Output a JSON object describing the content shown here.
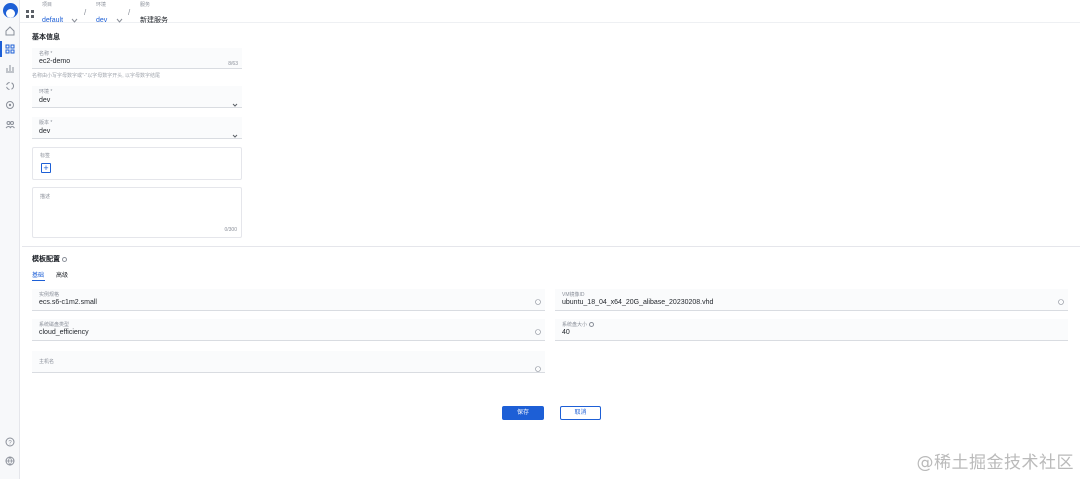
{
  "header": {
    "breadcrumbs": [
      {
        "label": "项目",
        "value": "default"
      },
      {
        "label": "环境",
        "value": "dev"
      },
      {
        "label": "服务",
        "value": "新建服务"
      }
    ]
  },
  "basic_info": {
    "title": "基本信息",
    "name_field": {
      "label": "名称 *",
      "value": "ec2-demo",
      "counter": "8/63",
      "hint": "名称由小写字母数字或\"-\"以字母数字开头, 以字母数字结尾"
    },
    "env_field": {
      "label": "环境 *",
      "value": "dev"
    },
    "version_field": {
      "label": "版本 *",
      "value": "dev"
    },
    "tags_field": {
      "label": "标签"
    },
    "desc_field": {
      "label": "描述",
      "counter": "0/300"
    }
  },
  "template_config": {
    "title": "模板配置",
    "tabs": [
      {
        "label": "基础",
        "active": true
      },
      {
        "label": "高级",
        "active": false
      }
    ],
    "fields": [
      {
        "label": "实例规格",
        "value": "ecs.s6-c1m2.small"
      },
      {
        "label": "VM镜像ID",
        "value": "ubuntu_18_04_x64_20G_alibase_20230208.vhd"
      },
      {
        "label": "系统磁盘类型",
        "value": "cloud_efficiency"
      },
      {
        "label": "系统盘大小",
        "value": "40"
      },
      {
        "label": "主机名",
        "value": ""
      }
    ]
  },
  "actions": {
    "save": "保存",
    "cancel": "取消"
  },
  "watermark": "@稀土掘金技术社区",
  "colors": {
    "primary": "#1d5fd6",
    "border": "#e5e6eb",
    "muted": "#8a8f99"
  },
  "icons": {
    "rail": [
      "home-icon",
      "apps-icon",
      "chart-icon",
      "cycle-icon",
      "settings-icon",
      "users-icon",
      "help-icon",
      "language-icon"
    ]
  }
}
